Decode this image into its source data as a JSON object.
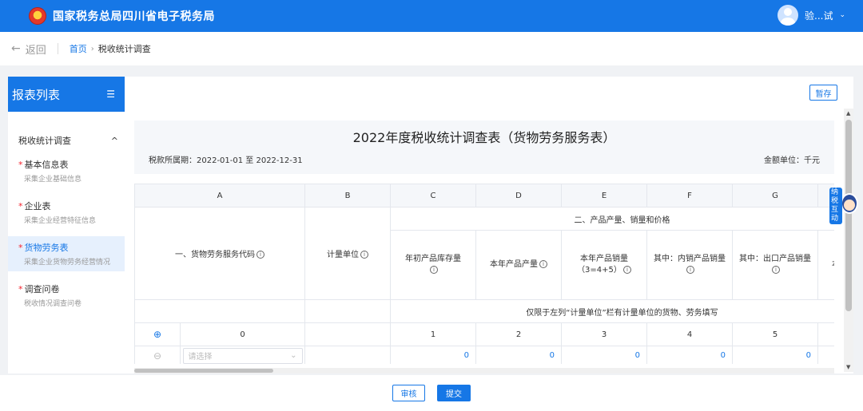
{
  "topbar": {
    "title": "国家税务总局四川省电子税务局",
    "user_name": "验...试",
    "user_chevron": "⌄"
  },
  "breadcrumb": {
    "back": "返回",
    "back_arrow": "←",
    "home": "首页",
    "separator": "›",
    "current": "税收统计调查"
  },
  "sidebar": {
    "title": "报表列表",
    "menu_icon": "☰",
    "group": "税收统计调查",
    "group_chevron": "^",
    "items": [
      {
        "label": "基本信息表",
        "sub": "采集企业基础信息",
        "required": "*"
      },
      {
        "label": "企业表",
        "sub": "采集企业经营特征信息",
        "required": "*"
      },
      {
        "label": "货物劳务表",
        "sub": "采集企业货物劳务经营情况",
        "required": "*"
      },
      {
        "label": "调查问卷",
        "sub": "税收情况调查问卷",
        "required": "*"
      }
    ]
  },
  "main": {
    "save_label": "暂存",
    "form_title": "2022年度税收统计调查表（货物劳务服务表）",
    "period": "税款所属期：2022-01-01 至 2022-12-31",
    "unit": "金额单位：千元"
  },
  "table": {
    "col_letters": [
      "A",
      "B",
      "C",
      "D",
      "E",
      "F",
      "G"
    ],
    "a_header": "一、货物劳务服务代码",
    "b_header": "计量单位",
    "group_header": "二、产品产量、销量和价格",
    "sub_headers": [
      "年初产品库存量",
      "本年产品产量",
      "本年产品销量（3=4+5）",
      "其中：内销产品销量",
      "其中：出口产品销量",
      "本"
    ],
    "note": "仅限于左列“计量单位”栏有计量单位的货物、劳务填写",
    "col_numbers": [
      "0",
      "1",
      "2",
      "3",
      "4",
      "5"
    ],
    "info_glyph": "i",
    "add_glyph": "⊕",
    "remove_glyph": "⊖",
    "select_placeholder": "请选择",
    "select_chevron": "⌄",
    "row_values": [
      "0",
      "0",
      "0",
      "0",
      "0"
    ]
  },
  "mascot": {
    "text": "纳税互动"
  },
  "bottom": {
    "review_label": "审核",
    "submit_label": "提交"
  },
  "colors": {
    "primary": "#1677e6",
    "required": "#f5222d"
  }
}
